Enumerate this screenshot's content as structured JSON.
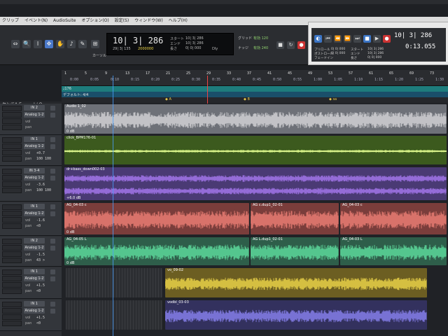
{
  "menu": {
    "items": [
      "クリップ",
      "イベント(N)",
      "AudioSuite",
      "オプション(O)",
      "設定(S)",
      "ウィンドウ(W)",
      "ヘルプ(H)"
    ]
  },
  "edit_toolbar": {
    "cursor_label": "カーソル",
    "main_counter": "10| 3| 286",
    "sub_counter": "29| 3| 135",
    "sub_counter2": "2000000",
    "start_label": "スタート",
    "end_label": "エンド",
    "length_label": "長さ",
    "start_val": "10| 3| 286",
    "end_val": "10| 3| 286",
    "length_val": "0| 0| 000",
    "dly_label": "Dly",
    "grid_label": "グリッド",
    "nudge_label": "ナッジ",
    "grid_val": "有効 120",
    "nudge_val": "有効 240"
  },
  "transport": {
    "preroll_label": "プリロール",
    "postroll_label": "ポストロール",
    "fade_label": "フェードイン",
    "start_label": "スタート",
    "end_label": "エンド",
    "length_label": "長さ",
    "preroll_val": "0| 0| 000",
    "postroll_val": "0| 0| 000",
    "start_val": "10| 3| 286",
    "end_val": "10| 3| 286",
    "length_val": "0| 0| 000",
    "main_bars": "10| 3| 286",
    "main_time": "0:13.055",
    "icons": [
      "online-icon",
      "rewind-to-start-icon",
      "rewind-icon",
      "fast-forward-icon",
      "go-to-end-icon",
      "stop-icon",
      "play-icon",
      "record-icon"
    ]
  },
  "ruler": {
    "bars": [
      "1",
      "5",
      "9",
      "13",
      "17",
      "21",
      "25",
      "29",
      "33",
      "37",
      "41",
      "45",
      "49",
      "53",
      "57",
      "61",
      "65",
      "69",
      "73",
      "77"
    ],
    "times": [
      "0:00",
      "0:05",
      "0:10",
      "0:15",
      "0:20",
      "0:25",
      "0:30",
      "0:35",
      "0:40",
      "0:45",
      "0:50",
      "0:55",
      "1:00",
      "1:05",
      "1:10",
      "1:15",
      "1:20",
      "1:25",
      "1:30",
      "1:35"
    ],
    "tempo_text": "♩176",
    "meter_text": "デフォルト: 4/4",
    "markers": [
      "A",
      "B",
      "sa"
    ]
  },
  "mixer_header": "センドA-E",
  "io_header": "I / O",
  "tracks": [
    {
      "name": "Audio 1_02",
      "input": "IN 2",
      "output": "Analog 1-2",
      "vol": "vol",
      "vol_val": "",
      "pan": "pan",
      "pan_val": "",
      "clip_name": "Audio 1_02",
      "foot": "0 dB",
      "color": "#6e7178",
      "wave": "#d7d8da"
    },
    {
      "name": "click_BPM176-01",
      "input": "IN 1",
      "output": "Analog 1-2",
      "vol": "vol",
      "vol_val": "+0.7",
      "pan": "pan",
      "pan_val": "100 100",
      "clip_name": "click_BPM176-01",
      "foot": "",
      "color": "#3c5a1e",
      "wave": "#b9e06a"
    },
    {
      "name": "dr-bass_down002-03",
      "input": "IN 3-4",
      "output": "Analog 1-2",
      "vol": "vol",
      "vol_val": "-3.6",
      "pan": "pan",
      "pan_val": "100 100",
      "clip_name": "dr+bass_down002-03",
      "foot": "+6.0 dB",
      "color": "#4a3a74",
      "wave": "#a779f0"
    },
    {
      "name": "AG_04-03",
      "input": "IN 1",
      "output": "Analog 1-2",
      "vol": "vol",
      "vol_val": "-1.6",
      "pan": "pan",
      "pan_val": "<0",
      "clip_name": "AG_04-03 c",
      "foot": "0 dB",
      "color": "#7a3d3b",
      "wave": "#f08077",
      "clip2": "AG c.dup1_02-01",
      "clip3": "AG_04-03 c"
    },
    {
      "name": "AG_04-05",
      "input": "IN 2",
      "output": "Analog 1-2",
      "vol": "vol",
      "vol_val": "-1.5",
      "pan": "pan",
      "pan_val": "43 >",
      "clip_name": "AG_04-05 L",
      "foot": "0 dB",
      "color": "#2e5e4a",
      "wave": "#5fe0a0",
      "clip2": "AG L.dup1_02-01",
      "clip3": "AG_04-03 L"
    },
    {
      "name": "vo_09-02",
      "input": "IN 1",
      "output": "Analog 1-2",
      "vol": "vol",
      "vol_val": "+1.5",
      "pan": "pan",
      "pan_val": "<0",
      "clip_name": "vo_09-02",
      "foot": "0 dB",
      "color": "#6c5e22",
      "wave": "#f0d84a"
    },
    {
      "name": "vodbl_03-03",
      "input": "IN 1",
      "output": "Analog 1-2",
      "vol": "vol",
      "vol_val": "+1.5",
      "pan": "pan",
      "pan_val": "<0",
      "clip_name": "vodbl_03-03",
      "foot": "0 dB",
      "color": "#33315e",
      "wave": "#8a84f2"
    }
  ],
  "colors": {
    "accent": "#4a78c8",
    "playhead": "#4aa0ff",
    "tempo": "#1e7c7c",
    "marker": "#e8c84a"
  }
}
